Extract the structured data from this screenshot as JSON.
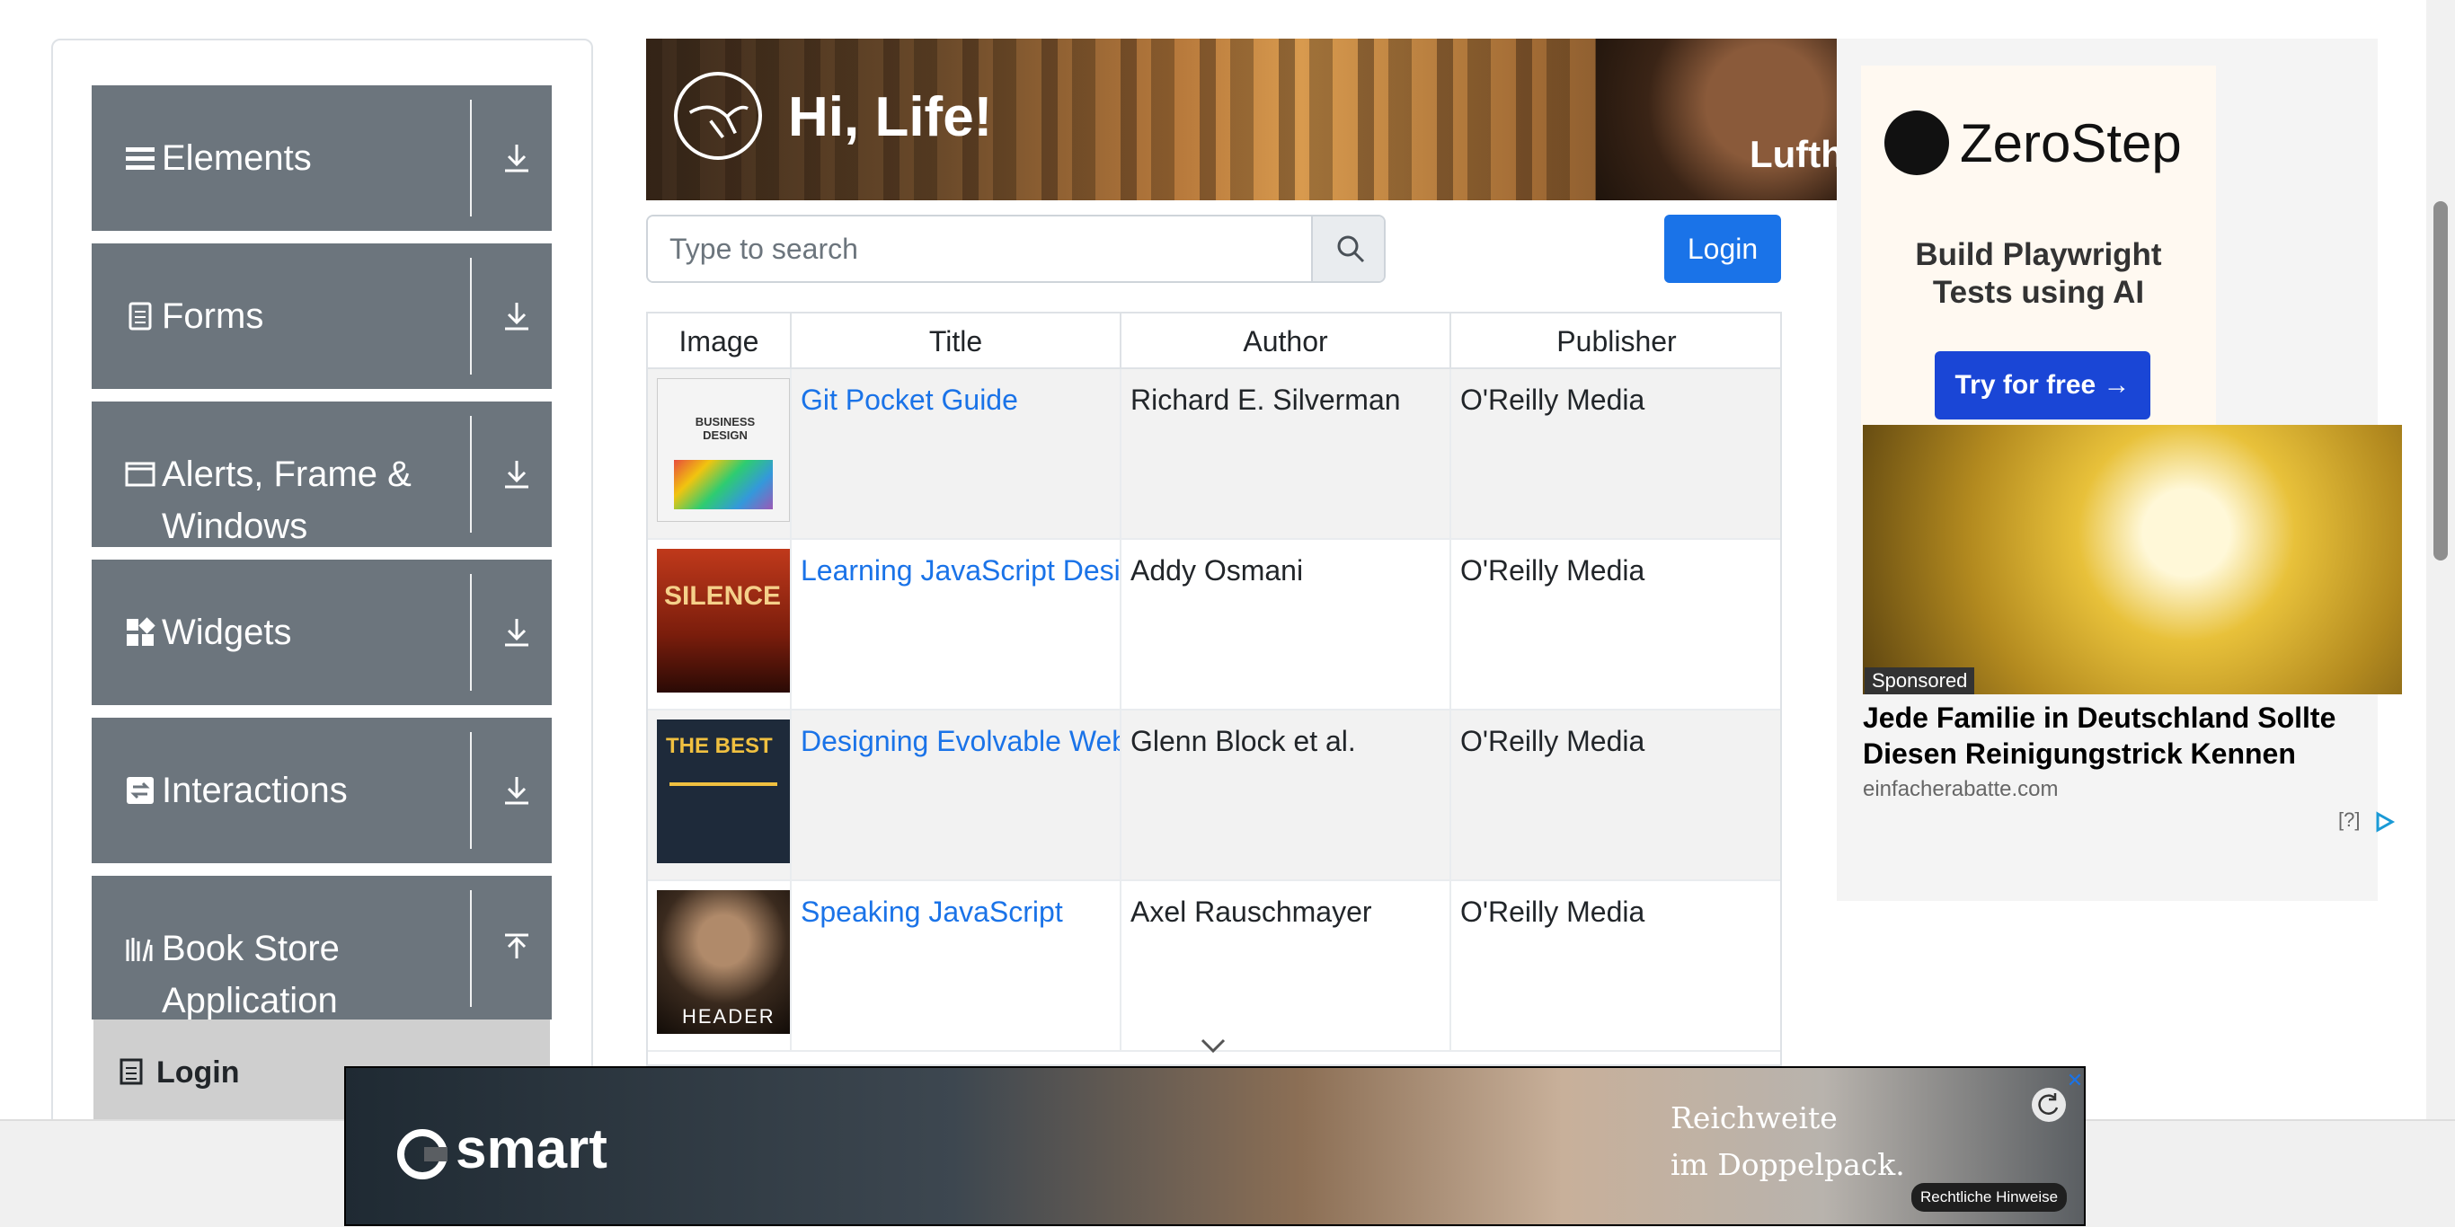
{
  "sidebar": {
    "items": [
      {
        "label": "Elements",
        "icon": "hamburger-icon",
        "arrow": "download-icon"
      },
      {
        "label": "Forms",
        "icon": "document-icon",
        "arrow": "download-icon"
      },
      {
        "label": "Alerts, Frame &",
        "label2": "Windows",
        "icon": "window-icon",
        "arrow": "download-icon"
      },
      {
        "label": "Widgets",
        "icon": "widgets-icon",
        "arrow": "download-icon"
      },
      {
        "label": "Interactions",
        "icon": "interactions-icon",
        "arrow": "download-icon"
      },
      {
        "label": "Book Store",
        "label2": "Application",
        "icon": "books-icon",
        "arrow": "upload-icon"
      }
    ],
    "active_sub_item": "Login"
  },
  "banner": {
    "greeting": "Hi, Life!",
    "brand_partial": "Lufth"
  },
  "search": {
    "placeholder": "Type to search",
    "button_icon": "search-icon"
  },
  "login_button": "Login",
  "table": {
    "headers": [
      "Image",
      "Title",
      "Author",
      "Publisher"
    ],
    "rows": [
      {
        "title": "Git Pocket Guide",
        "author": "Richard E. Silverman",
        "publisher": "O'Reilly Media",
        "cover_text": "BUSINESS DESIGN"
      },
      {
        "title": "Learning JavaScript Desi",
        "author": "Addy Osmani",
        "publisher": "O'Reilly Media",
        "cover_text": "SILENCE"
      },
      {
        "title": "Designing Evolvable Web",
        "author": "Glenn Block et al.",
        "publisher": "O'Reilly Media",
        "cover_text": "THE BEST"
      },
      {
        "title": "Speaking JavaScript",
        "author": "Axel Rauschmayer",
        "publisher": "O'Reilly Media",
        "cover_text": "HEADER"
      }
    ]
  },
  "side_ad": {
    "brand": "ZeroStep",
    "tagline": "Build Playwright Tests using AI",
    "cta": "Try for free →",
    "sponsored_label": "Sponsored",
    "headline": "Jede Familie in Deutschland Sollte Diesen Reinigungstrick Kennen",
    "domain": "einfacherabatte.com",
    "info": "[?]"
  },
  "bottom_ad": {
    "brand": "smart",
    "text_line1": "Reichweite",
    "text_line2": "im Doppelpack.",
    "legal": "Rechtliche Hinweise",
    "close": "✕"
  },
  "colors": {
    "primary": "#1a73e8",
    "sidebar_bg": "#6c757d",
    "zerostep_button": "#1a46d6"
  }
}
